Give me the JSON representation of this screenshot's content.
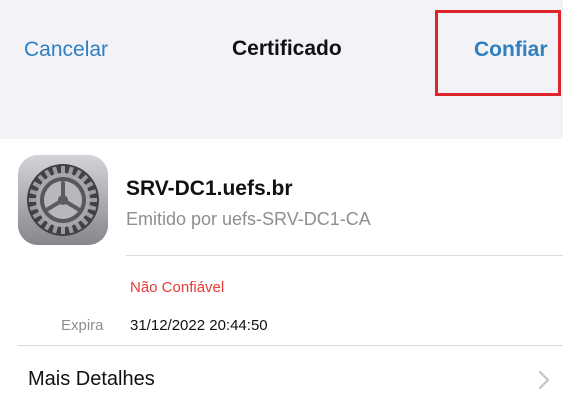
{
  "navbar": {
    "cancel_label": "Cancelar",
    "title": "Certificado",
    "trust_label": "Confiar"
  },
  "certificate": {
    "icon": "settings-gear-icon",
    "name": "SRV-DC1.uefs.br",
    "issuer": "Emitido por uefs-SRV-DC1-CA",
    "status": "Não Confiável",
    "expires_label": "Expira",
    "expires_value": "31/12/2022 20:44:50"
  },
  "details": {
    "label": "Mais Detalhes",
    "icon": "chevron-right-icon"
  },
  "colors": {
    "accent": "#2f7fc1",
    "warning": "#e43b33",
    "highlight_box": "#e0242b",
    "background": "#f2f2f7"
  }
}
